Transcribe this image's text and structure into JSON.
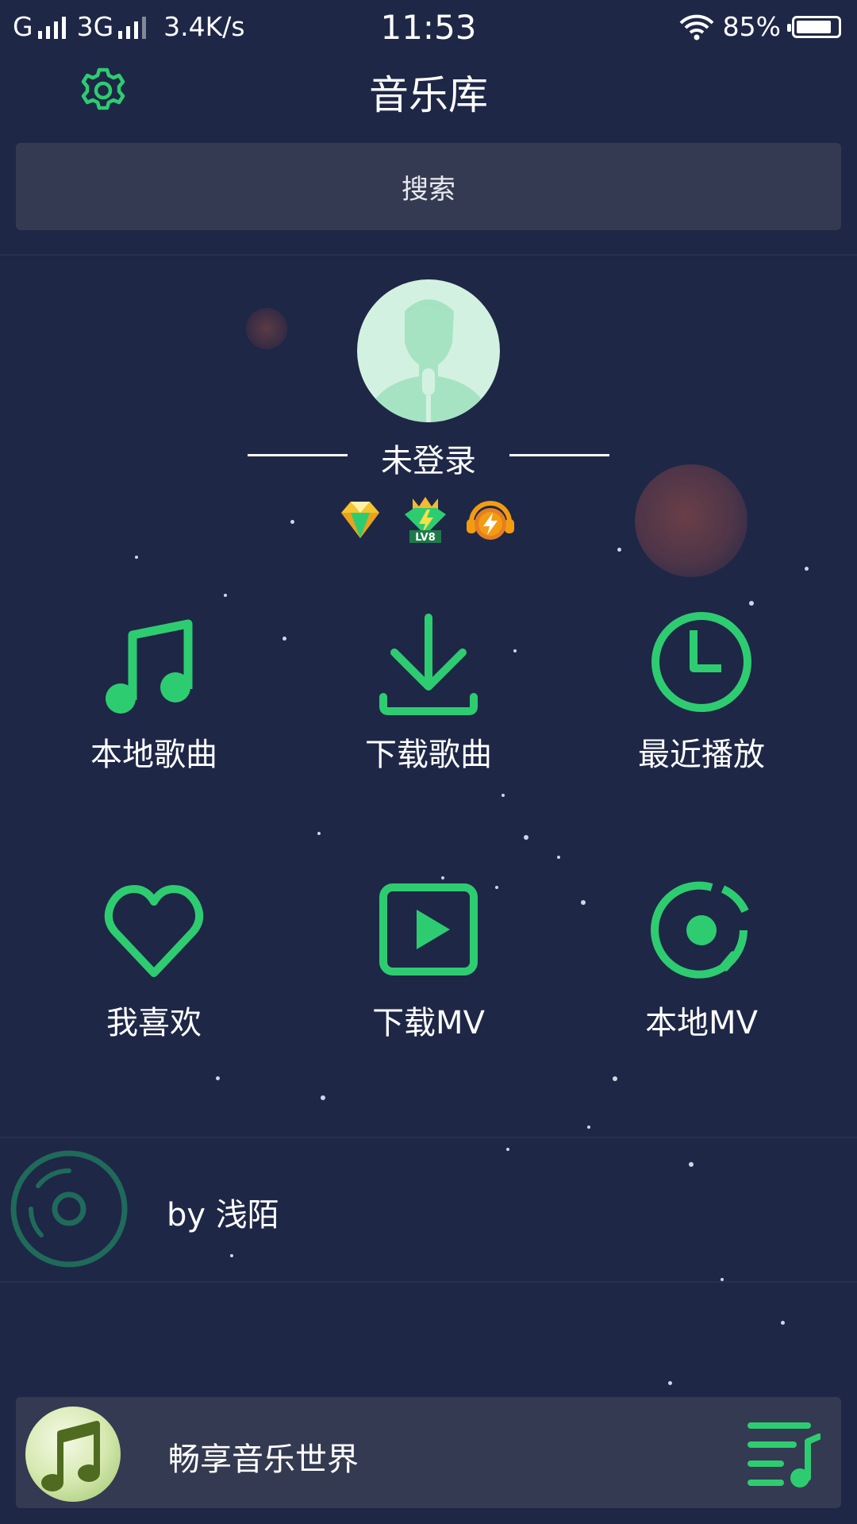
{
  "status_bar": {
    "network1": "G",
    "network2": "3G",
    "speed": "3.4K/s",
    "time": "11:53",
    "battery": "85%"
  },
  "header": {
    "title": "音乐库",
    "settings_icon": "gear-icon"
  },
  "search": {
    "placeholder": "搜索"
  },
  "profile": {
    "login_status": "未登录",
    "badges": [
      "diamond-icon",
      "level-lv8-icon",
      "speed-boost-icon"
    ],
    "level_text": "LV8"
  },
  "grid": [
    {
      "label": "本地歌曲",
      "icon": "music-note-icon"
    },
    {
      "label": "下载歌曲",
      "icon": "download-icon"
    },
    {
      "label": "最近播放",
      "icon": "clock-icon"
    },
    {
      "label": "我喜欢",
      "icon": "heart-icon"
    },
    {
      "label": "下载MV",
      "icon": "video-play-icon"
    },
    {
      "label": "本地MV",
      "icon": "local-mv-icon"
    }
  ],
  "now_playing": {
    "text": "by 浅陌"
  },
  "player": {
    "title": "畅享音乐世界"
  },
  "colors": {
    "background": "#1e2746",
    "accent": "#2ecc71",
    "panel": "#343a51"
  }
}
